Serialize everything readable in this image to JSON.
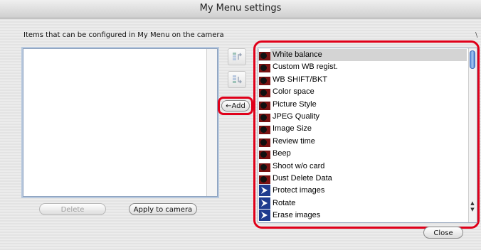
{
  "window": {
    "title": "My Menu settings"
  },
  "left_panel": {
    "caption": "Items that can be configured in My Menu on the camera",
    "items": [],
    "delete_label": "Delete",
    "apply_label": "Apply to camera"
  },
  "middle": {
    "add_label": "←Add",
    "move_up_icon": "move-up-icon",
    "move_down_icon": "move-down-icon"
  },
  "right_panel": {
    "items": [
      {
        "label": "White balance",
        "icon": "camera-shooting-menu-icon",
        "selected": true
      },
      {
        "label": "Custom WB regist.",
        "icon": "camera-shooting-menu-icon"
      },
      {
        "label": "WB SHIFT/BKT",
        "icon": "camera-shooting-menu-icon"
      },
      {
        "label": "Color space",
        "icon": "camera-shooting-menu-icon"
      },
      {
        "label": "Picture Style",
        "icon": "camera-shooting-menu-icon"
      },
      {
        "label": "JPEG Quality",
        "icon": "camera-shooting-menu-icon"
      },
      {
        "label": "Image Size",
        "icon": "camera-shooting-menu-icon"
      },
      {
        "label": "Review time",
        "icon": "camera-shooting-menu-icon"
      },
      {
        "label": "Beep",
        "icon": "camera-shooting-menu-icon"
      },
      {
        "label": "Shoot w/o card",
        "icon": "camera-shooting-menu-icon"
      },
      {
        "label": "Dust Delete Data",
        "icon": "camera-shooting-menu-icon"
      },
      {
        "label": "Protect images",
        "icon": "playback-menu-icon"
      },
      {
        "label": "Rotate",
        "icon": "playback-menu-icon"
      },
      {
        "label": "Erase images",
        "icon": "playback-menu-icon"
      }
    ]
  },
  "footer": {
    "close_label": "Close"
  },
  "colors": {
    "highlight": "#e0001a",
    "shooting_icon": "#7a1212",
    "playback_icon": "#1f3c8f",
    "selection": "#d4d4d4"
  }
}
